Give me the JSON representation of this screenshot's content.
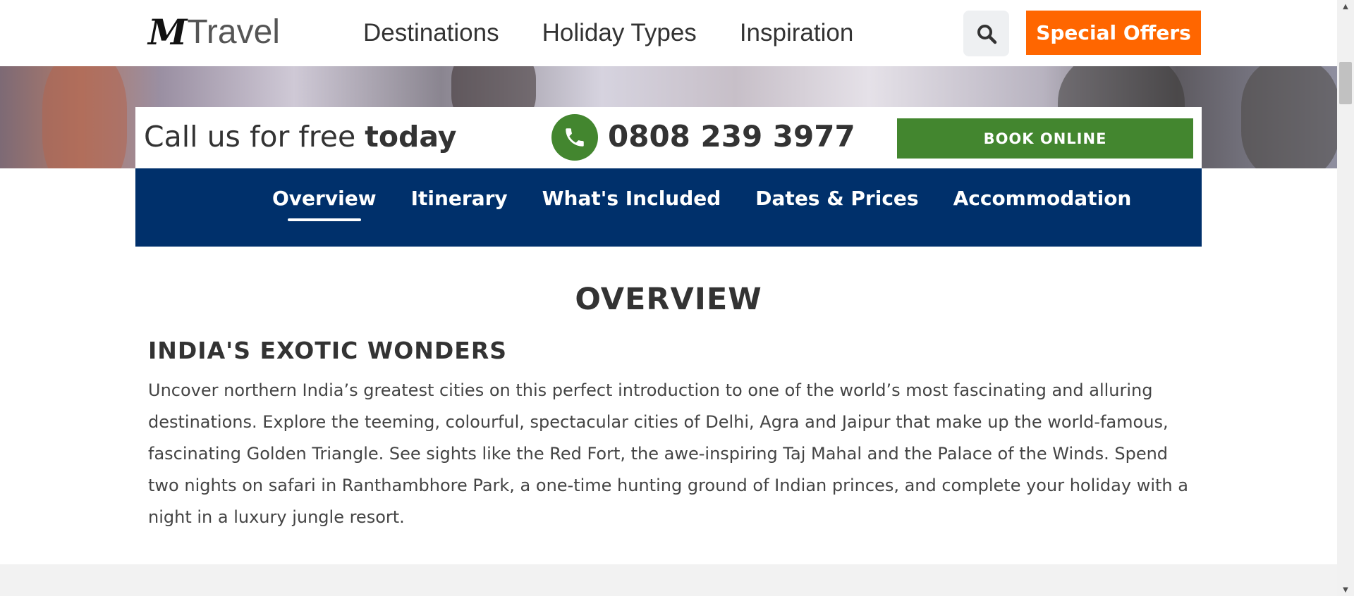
{
  "header": {
    "logo_mark": "M",
    "logo_text": "Travel",
    "nav": [
      "Destinations",
      "Holiday Types",
      "Inspiration"
    ],
    "search_icon": "search-icon",
    "offers_label": "Special Offers"
  },
  "callbar": {
    "call_text": "Call us for free ",
    "call_text_bold": "today",
    "phone_icon": "phone-icon",
    "phone_number": "0808 239 3977",
    "book_label": "BOOK ONLINE"
  },
  "subnav": {
    "items": [
      "Overview",
      "Itinerary",
      "What's Included",
      "Dates & Prices",
      "Accommodation"
    ],
    "active": "Overview"
  },
  "content": {
    "section_title": "OVERVIEW",
    "subheading": "INDIA'S EXOTIC WONDERS",
    "body": "Uncover northern India’s greatest cities on this perfect introduction to one of the world’s most fascinating and alluring destinations. Explore the teeming, colourful, spectacular cities of Delhi, Agra and Jaipur that make up the world-famous, fascinating Golden Triangle. See sights like the Red Fort, the awe-inspiring Taj Mahal and the Palace of the Winds. Spend two nights on safari in Ranthambhore Park, a one-time hunting ground of Indian princes, and complete your holiday with a night in a luxury jungle resort."
  },
  "colors": {
    "offers": "#ff6600",
    "book": "#43862f",
    "phone": "#43862f",
    "subnav": "#00306b"
  }
}
